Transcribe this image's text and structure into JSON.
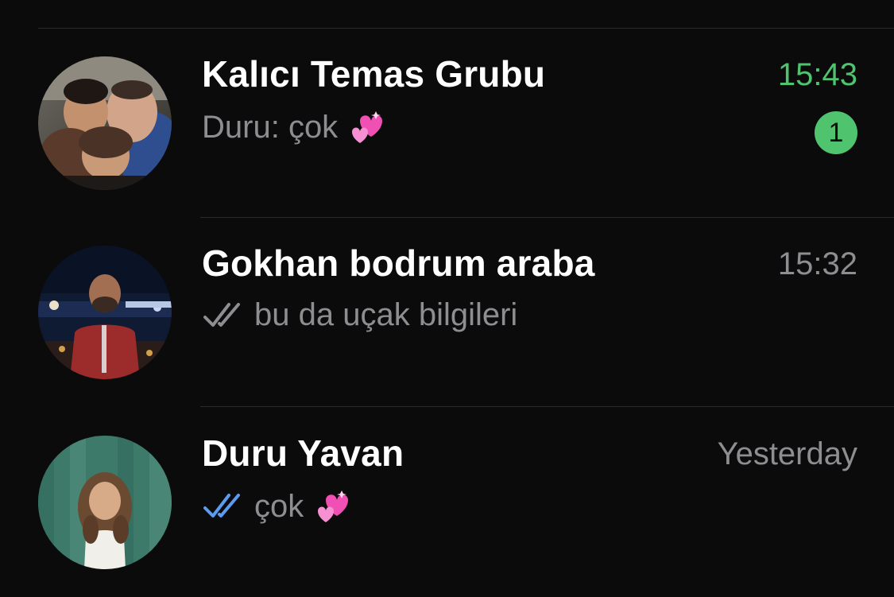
{
  "chats": [
    {
      "title": "Kalıcı Temas Grubu",
      "time": "15:43",
      "preview_sender": "Duru:",
      "preview_text": "çok",
      "preview_emoji": "two-hearts-emoji",
      "unread_count": "1",
      "time_color": "#4fc36d",
      "avatar": "group-photo-avatar"
    },
    {
      "title": "Gokhan bodrum araba",
      "time": "15:32",
      "preview_text": "bu da uçak bilgileri",
      "read_status": "delivered-double-check-gray",
      "avatar": "man-night-photo-avatar"
    },
    {
      "title": "Duru Yavan",
      "time": "Yesterday",
      "preview_text": "çok",
      "preview_emoji": "two-hearts-emoji",
      "read_status": "read-double-check-blue",
      "avatar": "woman-photo-avatar"
    }
  ],
  "colors": {
    "background": "#0b0b0b",
    "accent_green": "#4fc36d",
    "read_blue": "#5b9cf2",
    "secondary_text": "#8d8d92"
  }
}
